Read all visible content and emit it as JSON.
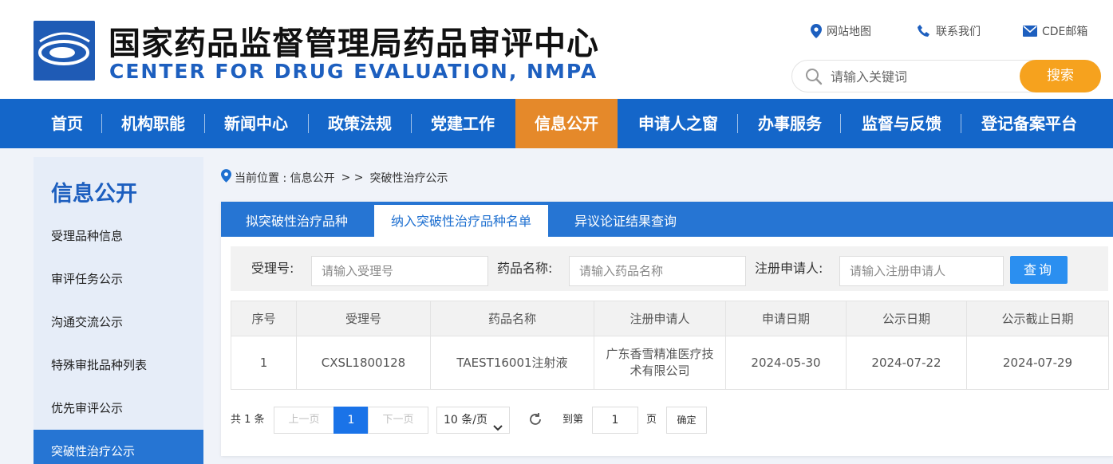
{
  "header": {
    "title_cn": "国家药品监督管理局药品审评中心",
    "title_en": "CENTER FOR DRUG EVALUATION, NMPA",
    "links": {
      "sitemap": "网站地图",
      "contact": "联系我们",
      "email": "CDE邮箱"
    },
    "search": {
      "placeholder": "请输入关键词",
      "button": "搜索"
    }
  },
  "nav": {
    "items": [
      "首页",
      "机构职能",
      "新闻中心",
      "政策法规",
      "党建工作",
      "信息公开",
      "申请人之窗",
      "办事服务",
      "监督与反馈",
      "登记备案平台"
    ],
    "active_index": 5
  },
  "sidebar": {
    "title": "信息公开",
    "items": [
      "受理品种信息",
      "审评任务公示",
      "沟通交流公示",
      "特殊审批品种列表",
      "优先审评公示",
      "突破性治疗公示"
    ],
    "active_index": 5
  },
  "breadcrumb": {
    "prefix": "当前位置 : 信息公开",
    "sep": "> >",
    "current": "突破性治疗公示"
  },
  "tabs": [
    "拟突破性治疗品种",
    "纳入突破性治疗品种名单",
    "异议论证结果查询"
  ],
  "active_tab": 1,
  "filter": {
    "accept_no_label": "受理号:",
    "accept_no_placeholder": "请输入受理号",
    "drug_name_label": "药品名称:",
    "drug_name_placeholder": "请输入药品名称",
    "applicant_label": "注册申请人:",
    "applicant_placeholder": "请输入注册申请人",
    "query_button": "查询"
  },
  "table": {
    "columns": [
      "序号",
      "受理号",
      "药品名称",
      "注册申请人",
      "申请日期",
      "公示日期",
      "公示截止日期"
    ],
    "rows": [
      [
        "1",
        "CXSL1800128",
        "TAEST16001注射液",
        "广东香雪精准医疗技术有限公司",
        "2024-05-30",
        "2024-07-22",
        "2024-07-29"
      ]
    ]
  },
  "pager": {
    "total": "共 1 条",
    "prev": "上一页",
    "current": "1",
    "next": "下一页",
    "page_size": "10 条/页",
    "goto_label": "到第",
    "goto_value": "1",
    "page_unit": "页",
    "confirm": "确定"
  },
  "colors": {
    "brand_blue": "#1466c9",
    "nav_active": "#e5892a",
    "search_button": "#f6a21e",
    "query_button": "#2b8ff0"
  }
}
